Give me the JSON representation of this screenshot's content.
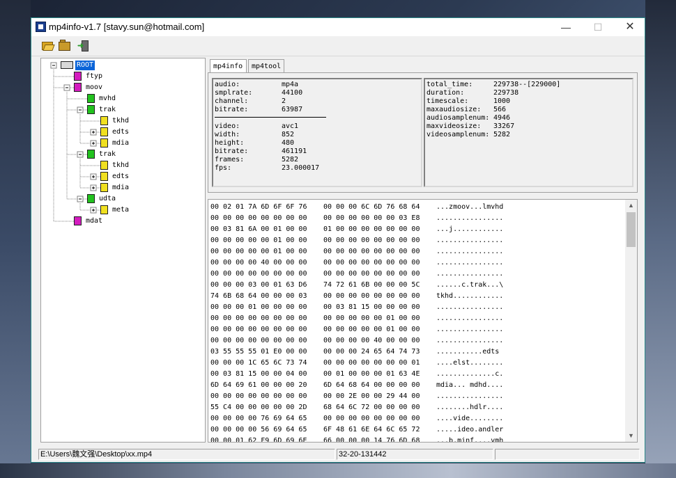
{
  "window": {
    "title": "mp4info-v1.7 [stavy.sun@hotmail.com]",
    "controls": {
      "minimize": "—",
      "maximize": "☐",
      "close": "✕"
    }
  },
  "toolbar": {
    "open_icon": "folder-open-icon",
    "save_icon": "folder-save-icon",
    "exit_icon": "exit-icon"
  },
  "tree": [
    {
      "label": "ROOT",
      "depth": 0,
      "expander": "minus",
      "color": "#e0e0e0",
      "selected": true
    },
    {
      "label": "ftyp",
      "depth": 1,
      "expander": "none",
      "color": "#d41cbf"
    },
    {
      "label": "moov",
      "depth": 1,
      "expander": "minus",
      "color": "#d41cbf"
    },
    {
      "label": "mvhd",
      "depth": 2,
      "expander": "none",
      "color": "#22c21e"
    },
    {
      "label": "trak",
      "depth": 2,
      "expander": "minus",
      "color": "#22c21e"
    },
    {
      "label": "tkhd",
      "depth": 3,
      "expander": "none",
      "color": "#f0e020"
    },
    {
      "label": "edts",
      "depth": 3,
      "expander": "plus",
      "color": "#f0e020"
    },
    {
      "label": "mdia",
      "depth": 3,
      "expander": "plus",
      "color": "#f0e020"
    },
    {
      "label": "trak",
      "depth": 2,
      "expander": "minus",
      "color": "#22c21e"
    },
    {
      "label": "tkhd",
      "depth": 3,
      "expander": "none",
      "color": "#f0e020"
    },
    {
      "label": "edts",
      "depth": 3,
      "expander": "plus",
      "color": "#f0e020"
    },
    {
      "label": "mdia",
      "depth": 3,
      "expander": "plus",
      "color": "#f0e020"
    },
    {
      "label": "udta",
      "depth": 2,
      "expander": "minus",
      "color": "#22c21e"
    },
    {
      "label": "meta",
      "depth": 3,
      "expander": "plus",
      "color": "#f0e020"
    },
    {
      "label": "mdat",
      "depth": 1,
      "expander": "none",
      "color": "#d41cbf"
    }
  ],
  "tabs": [
    {
      "label": "mp4info",
      "active": true
    },
    {
      "label": "mp4tool",
      "active": false
    }
  ],
  "info_left": [
    {
      "key": "audio:",
      "value": "mp4a"
    },
    {
      "key": "smplrate:",
      "value": "44100"
    },
    {
      "key": "channel:",
      "value": "2"
    },
    {
      "key": "bitrate:",
      "value": "63987"
    },
    {
      "key": "video:",
      "value": "avc1"
    },
    {
      "key": "width:",
      "value": "852"
    },
    {
      "key": "height:",
      "value": "480"
    },
    {
      "key": "bitrate:",
      "value": "461191"
    },
    {
      "key": "frames:",
      "value": "5282"
    },
    {
      "key": "fps:",
      "value": "23.000017"
    }
  ],
  "info_right": [
    {
      "key": "total_time:",
      "value": "229738--[229000]"
    },
    {
      "key": "duration:",
      "value": "229738"
    },
    {
      "key": "timescale:",
      "value": "1000"
    },
    {
      "key": "maxaudiosize:",
      "value": "566"
    },
    {
      "key": "audiosamplenum:",
      "value": "4946"
    },
    {
      "key": "maxvideosize:",
      "value": "33267"
    },
    {
      "key": "videosamplenum:",
      "value": "5282"
    }
  ],
  "hex_rows": [
    [
      "00 02 01 7A 6D 6F 6F 76",
      "00 00 00 6C 6D 76 68 64",
      "...zmoov...lmvhd"
    ],
    [
      "00 00 00 00 00 00 00 00",
      "00 00 00 00 00 00 03 E8",
      "................"
    ],
    [
      "00 03 81 6A 00 01 00 00",
      "01 00 00 00 00 00 00 00",
      "...j............"
    ],
    [
      "00 00 00 00 00 01 00 00",
      "00 00 00 00 00 00 00 00",
      "................"
    ],
    [
      "00 00 00 00 00 01 00 00",
      "00 00 00 00 00 00 00 00",
      "................"
    ],
    [
      "00 00 00 00 40 00 00 00",
      "00 00 00 00 00 00 00 00",
      "................"
    ],
    [
      "00 00 00 00 00 00 00 00",
      "00 00 00 00 00 00 00 00",
      "................"
    ],
    [
      "00 00 00 03 00 01 63 D6",
      "74 72 61 6B 00 00 00 5C",
      "......c.trak...\\"
    ],
    [
      "74 6B 68 64 00 00 00 03",
      "00 00 00 00 00 00 00 00",
      "tkhd............"
    ],
    [
      "00 00 00 01 00 00 00 00",
      "00 03 81 15 00 00 00 00",
      "................"
    ],
    [
      "00 00 00 00 00 00 00 00",
      "00 00 00 00 00 01 00 00",
      "................"
    ],
    [
      "00 00 00 00 00 00 00 00",
      "00 00 00 00 00 01 00 00",
      "................"
    ],
    [
      "00 00 00 00 00 00 00 00",
      "00 00 00 00 40 00 00 00",
      "................"
    ],
    [
      "03 55 55 55 01 E0 00 00",
      "00 00 00 24 65 64 74 73",
      "...........edts"
    ],
    [
      "00 00 00 1C 65 6C 73 74",
      "00 00 00 00 00 00 00 01",
      "....elst........"
    ],
    [
      "00 03 81 15 00 00 04 00",
      "00 01 00 00 00 01 63 4E",
      "..............c."
    ],
    [
      "6D 64 69 61 00 00 00 20",
      "6D 64 68 64 00 00 00 00",
      "mdia... mdhd...."
    ],
    [
      "00 00 00 00 00 00 00 00",
      "00 00 2E 00 00 29 44 00",
      "................"
    ],
    [
      "55 C4 00 00 00 00 00 2D",
      "68 64 6C 72 00 00 00 00",
      "........hdlr...."
    ],
    [
      "00 00 00 00 76 69 64 65",
      "00 00 00 00 00 00 00 00",
      "....vide........"
    ],
    [
      "00 00 00 00 56 69 64 65",
      "6F 48 61 6E 64 6C 65 72",
      ".....ideo.andler"
    ],
    [
      "00 00 01 62 F9 6D 69 6E",
      "66 00 00 00 14 76 6D 68",
      "...b.minf....vmh"
    ]
  ],
  "status": {
    "path": "E:\\Users\\魏文强\\Desktop\\xx.mp4",
    "offset": "32-20-131442",
    "extra": ""
  }
}
